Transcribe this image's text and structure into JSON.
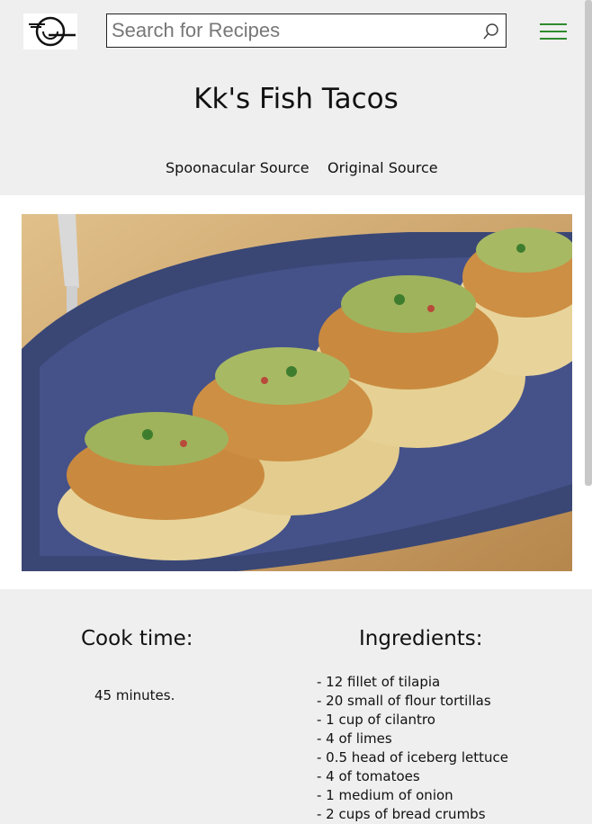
{
  "header": {
    "search_placeholder": "Search for Recipes",
    "menu_icon": "hamburger-menu-icon",
    "search_icon": "magnifier-icon",
    "logo_icon": "plate-fork-logo-icon"
  },
  "recipe": {
    "title": "Kk's Fish Tacos",
    "links": [
      "Spoonacular Source",
      "Original Source"
    ],
    "image_alt": "fish tacos photo"
  },
  "details": {
    "cook_time_label": "Cook time:",
    "cook_time_value": "45 minutes.",
    "ingredients_label": "Ingredients:",
    "ingredients": [
      "- 12 fillet of tilapia",
      "- 20 small of flour tortillas",
      "- 1 cup of cilantro",
      "- 4 of limes",
      "- 0.5 head of iceberg lettuce",
      "- 4 of tomatoes",
      "- 1 medium of onion",
      "- 2 cups of bread crumbs"
    ]
  },
  "colors": {
    "accent": "#2e8b2e",
    "background": "#efefef"
  }
}
